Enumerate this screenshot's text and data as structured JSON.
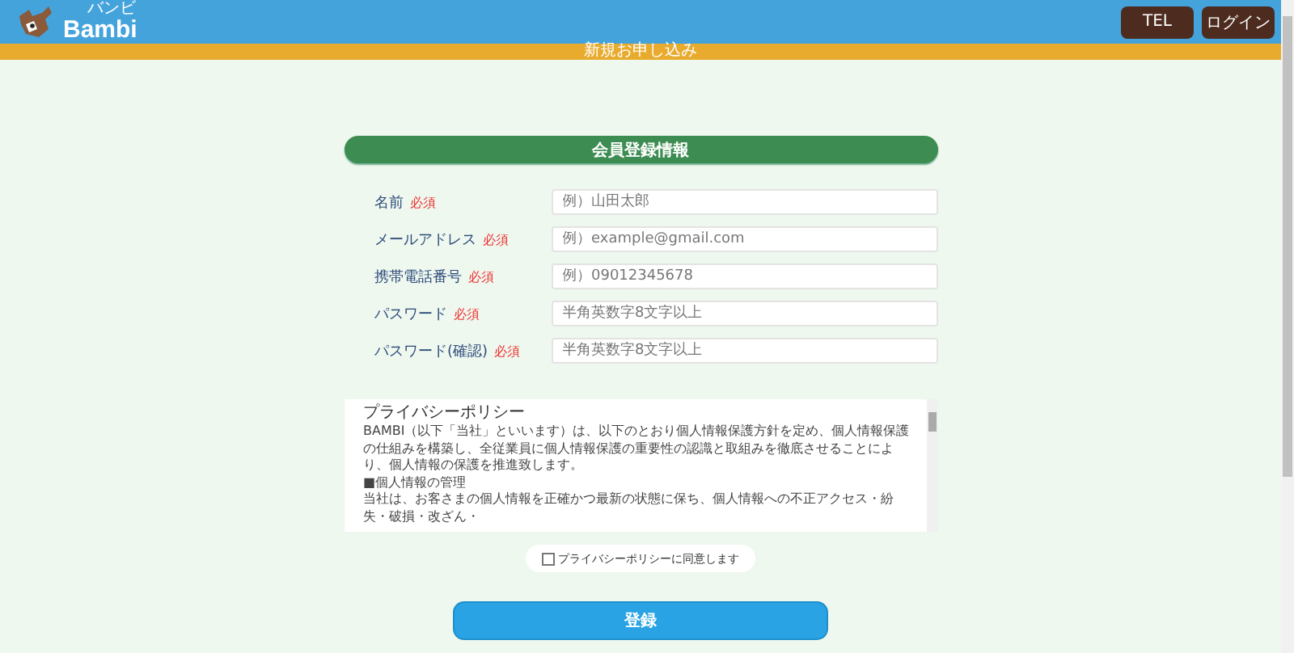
{
  "header": {
    "logo": "Bambi",
    "logo_ruby": "バンビ",
    "buttons": [
      "TEL",
      "ログイン"
    ]
  },
  "banner": "新規お申し込み",
  "form": {
    "title": "会員登録情報",
    "fields": [
      {
        "label": "名前",
        "required": "必須",
        "placeholder": "例）山田太郎"
      },
      {
        "label": "メールアドレス",
        "required": "必須",
        "placeholder": "例）example@gmail.com"
      },
      {
        "label": "携帯電話番号",
        "required": "必須",
        "placeholder": "例）09012345678"
      },
      {
        "label": "パスワード",
        "required": "必須",
        "placeholder": "半角英数字8文字以上"
      },
      {
        "label": "パスワード(確認)",
        "required": "必須",
        "placeholder": "半角英数字8文字以上"
      }
    ]
  },
  "policy": {
    "title": "プライバシーポリシー",
    "paragraphs": [
      "BAMBI（以下「当社」といいます）は、以下のとおり個人情報保護方針を定め、個人情報保護の仕組みを構築し、全従業員に個人情報保護の重要性の認識と取組みを徹底させることにより、個人情報の保護を推進致します。",
      "■個人情報の管理",
      "当社は、お客さまの個人情報を正確かつ最新の状態に保ち、個人情報への不正アクセス・紛失・破損・改ざん・"
    ]
  },
  "agree": {
    "label": "プライバシーポリシーに同意します",
    "checked": false
  },
  "submit": "登録"
}
